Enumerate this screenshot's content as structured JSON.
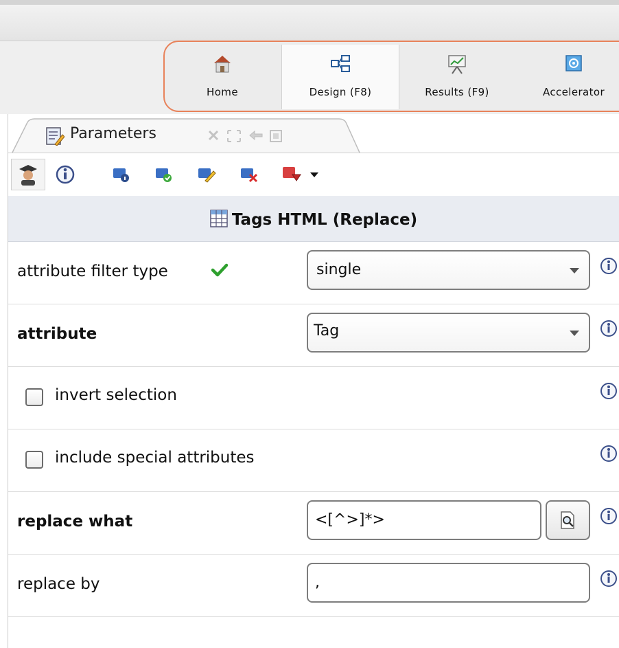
{
  "perspectives": [
    {
      "label": "Home",
      "icon": "home-icon"
    },
    {
      "label": "Design (F8)",
      "icon": "design-icon",
      "active": true
    },
    {
      "label": "Results (F9)",
      "icon": "results-icon"
    },
    {
      "label": "Accelerator",
      "icon": "accelerator-icon"
    }
  ],
  "panel": {
    "tab_label": "Parameters",
    "operator_title": "Tags HTML (Replace)"
  },
  "toolbar": {
    "buttons": [
      "expert-mode-icon",
      "info-icon",
      "operator-info-icon",
      "operator-enable-icon",
      "rename-icon",
      "delete-icon",
      "export-icon",
      "dropdown-icon"
    ]
  },
  "params": {
    "attribute_filter_type": {
      "label": "attribute filter type",
      "value": "single"
    },
    "attribute": {
      "label": "attribute",
      "value": "Tag"
    },
    "invert_selection": {
      "label": "invert selection",
      "checked": false
    },
    "include_special_attributes": {
      "label": "include special attributes",
      "checked": false
    },
    "replace_what": {
      "label": "replace what",
      "value": "<[^>]*>"
    },
    "replace_by": {
      "label": "replace by",
      "value": ","
    }
  },
  "colors": {
    "perspective_border": "#e8825a",
    "header_bg": "#e9ecf2",
    "checkmark_green": "#2ea02e"
  }
}
